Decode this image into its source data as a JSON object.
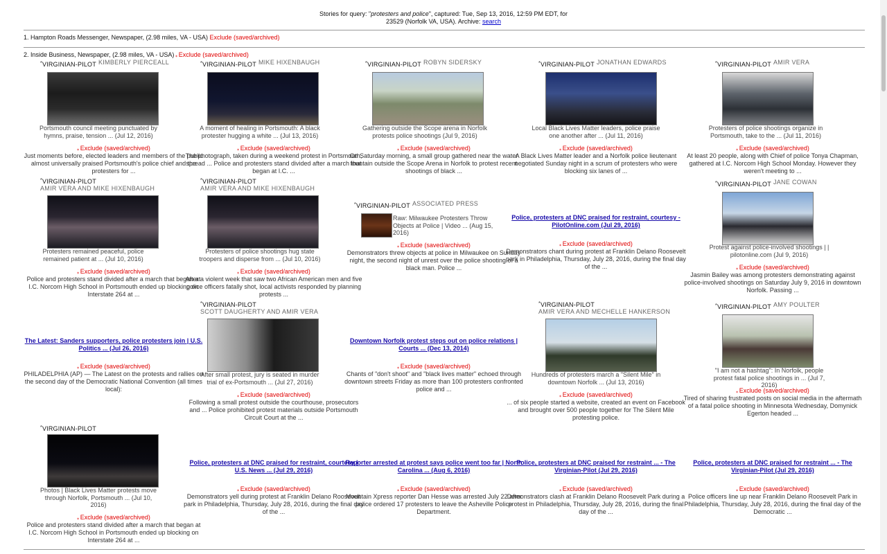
{
  "header": {
    "prefix": "Stories for query: \"",
    "query": "protesters and police",
    "middle": "\", captured: Tue, Sep 13, 2016, 12:59 PM EDT, for",
    "line2": "23529 (Norfolk VA, USA). Archive: ",
    "archive_link": "search"
  },
  "sources": [
    {
      "label": "1. Hampton Roads Messenger, Newspaper, (2.98 miles, VA - USA)",
      "exclude": "Exclude (saved/archived)"
    },
    {
      "label": "2. Inside Business, Newspaper, (2.98 miles, VA - USA)",
      "exclude": "Exclude (saved/archived)"
    }
  ],
  "exclude_label": "Exclude (saved/archived)",
  "publisher": "VIRGINIAN-PILOT",
  "stories": [
    {
      "author": "KIMBERLY PIERCEALL",
      "caption": "Portsmouth council meeting punctuated by hymns, praise, tension ... (Jul 12, 2016)",
      "snippet": "Just moments before, elected leaders and members of the public almost universally praised Portsmouth's police chief and the protesters for ..."
    },
    {
      "author": "MIKE HIXENBAUGH",
      "caption": "A moment of healing in Portsmouth: A black protester hugging a white ... (Jul 13, 2016)",
      "snippet": "The photograph, taken during a weekend protest in Portsmouth, spread ... Police and protesters stand divided after a march that began at I.C. ..."
    },
    {
      "author": "ROBYN SIDERSKY",
      "caption": "Gathering outside the Scope arena in Norfolk protests police shootings (Jul 9, 2016)",
      "snippet": "On Saturday morning, a small group gathered near the water fountain outside the Scope Arena in Norfolk to protest recent shootings of black ..."
    },
    {
      "author": "JONATHAN EDWARDS",
      "caption": "Local Black Lives Matter leaders, police praise one another after ... (Jul 11, 2016)",
      "snippet": "A Black Lives Matter leader and a Norfolk police lieutenant negotiated Sunday night in a scrum of protesters who were blocking six lanes of ..."
    },
    {
      "author": "AMIR VERA",
      "caption": "Protesters of police shootings organize in Portsmouth, take to the ... (Jul 11, 2016)",
      "snippet": "At least 20 people, along with Chief of police Tonya Chapman, gathered at I.C. Norcom High School Monday. However they weren't meeting to ..."
    },
    {
      "author": "AMIR VERA AND MIKE HIXENBAUGH",
      "caption": "Protesters remained peaceful, police remained patient at ... (Jul 10, 2016)",
      "snippet": "Police and protesters stand divided after a march that began at I.C. Norcom High School in Portsmouth ended up blocking on Interstate 264 at ..."
    },
    {
      "author": "AMIR VERA AND MIKE HIXENBAUGH",
      "caption": "Protesters of police shootings hug state troopers and disperse from ... (Jul 10, 2016)",
      "snippet": "After a violent week that saw two African American men and five police officers fatally shot, local activists responded by planning protests ..."
    },
    {
      "author": "ASSOCIATED PRESS",
      "caption": "Raw: Milwaukee Protesters Throw Objects at Police | Video ... (Aug 15, 2016)",
      "snippet": "Demonstrators threw objects at police in Milwaukee on Sunday night, the second night of unrest over the police shooting of a black man. Police ..."
    },
    {
      "title": "Police, protesters at DNC praised for restraint, courtesy - PilotOnline.com (Jul 29, 2016)",
      "snippet": "Demonstrators chant during protest at Franklin Delano Roosevelt park in Philadelphia, Thursday, July 28, 2016, during the final day of the ..."
    },
    {
      "author": "JANE COWAN",
      "caption": "Protest against police-involved shootings | | pilotonline.com (Jul 9, 2016)",
      "snippet": "Jasmin Bailey was among protesters demonstrating against police-involved shootings on Saturday July 9, 2016 in downtown Norfolk. Passing ..."
    },
    {
      "title": "The Latest: Sanders supporters, police protesters join | U.S. Politics ... (Jul 26, 2016)",
      "snippet": "PHILADELPHIA (AP) — The Latest on the protests and rallies on the second day of the Democratic National Convention (all times local):"
    },
    {
      "author": "SCOTT DAUGHERTY AND AMIR VERA",
      "caption": "After small protest, jury is seated in murder trial of ex-Portsmouth ... (Jul 27, 2016)",
      "snippet": "Following a small protest outside the courthouse, prosecutors and ... Police prohibited protest materials outside Portsmouth Circuit Court at the ..."
    },
    {
      "title": "Downtown Norfolk protest steps out on police relations | Courts ... (Dec 13, 2014)",
      "snippet": "Chants of \"don't shoot\" and \"black lives matter\" echoed through downtown streets Friday as more than 100 protesters confronted police and ..."
    },
    {
      "author": "AMIR VERA AND MECHELLE HANKERSON",
      "caption": "Hundreds of protesters march a \"Silent Mile\" in downtown Norfolk ... (Jul 13, 2016)",
      "snippet": "... of six people started a website, created an event on Facebook and brought over 500 people together for The Silent Mile protesting police."
    },
    {
      "author": "AMY POULTER",
      "caption": "\"I am not a hashtag\": In Norfolk, people protest fatal police shootings in ... (Jul 7, 2016)",
      "snippet": "Tired of sharing frustrated posts on social media in the aftermath of a fatal police shooting in Minnesota Wednesday, Domynick Egerton headed ..."
    },
    {
      "author": "",
      "caption": "Photos | Black Lives Matter protests move through Norfolk, Portsmouth ... (Jul 10, 2016)",
      "snippet": "Police and protesters stand divided after a march that began at I.C. Norcom High School in Portsmouth ended up blocking on Interstate 264 at ..."
    },
    {
      "title": "Police, protesters at DNC praised for restraint, courtesy | U.S. News ... (Jul 29, 2016)",
      "snippet": "Demonstrators yell during protest at Franklin Delano Roosevelt park in Philadelphia, Thursday, July 28, 2016, during the final day of the ..."
    },
    {
      "title": "Reporter arrested at protest says police went too far | North Carolina ... (Aug 6, 2016)",
      "snippet": "Mountain Xpress reporter Dan Hesse was arrested July 22 after police ordered 17 protesters to leave the Asheville Police Department."
    },
    {
      "title": "Police, protesters at DNC praised for restraint ... - The Virginian-Pilot (Jul 29, 2016)",
      "snippet": "Demonstrators clash at Franklin Delano Roosevelt Park during a protest in Philadelphia, Thursday, July 28, 2016, during the final day of the ..."
    },
    {
      "title": "Police, protesters at DNC praised for restraint ... - The Virginian-Pilot (Jul 29, 2016)",
      "snippet": "Police officers line up near Franklin Delano Roosevelt Park in Philadelphia, Thursday, July 28, 2016, during the final day of the Democratic ..."
    }
  ]
}
